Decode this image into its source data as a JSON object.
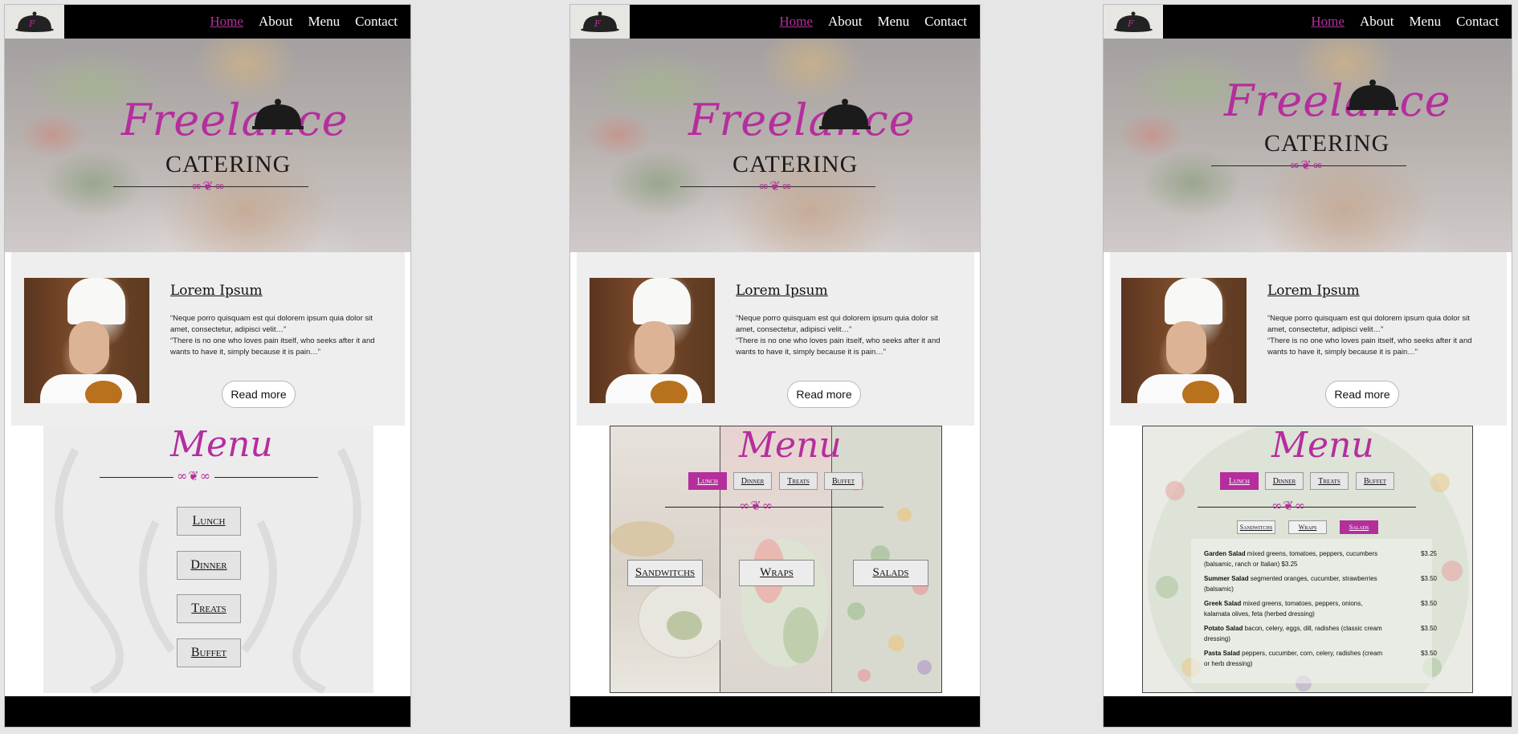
{
  "nav": {
    "items": [
      "Home",
      "About",
      "Menu",
      "Contact"
    ]
  },
  "brand": {
    "script": "Freelance",
    "block": "CATERING",
    "logo_icon": "cloche-icon"
  },
  "about": {
    "title": "Lorem Ipsum",
    "quote1": "“Neque porro quisquam est qui dolorem ipsum quia dolor sit amet, consectetur, adipisci velit…”",
    "quote2": "“There is no one who loves pain itself, who seeks after it and wants to have it, simply because it is pain…”",
    "button": "Read more"
  },
  "menu": {
    "title": "Menu",
    "categories": [
      "Lunch",
      "Dinner",
      "Treats",
      "Buffet"
    ],
    "lunch_sections": [
      "Sandwitchs",
      "Wraps",
      "Salads"
    ],
    "salads": [
      {
        "name": "Garden Salad",
        "desc": " mixed greens, tomatoes, peppers, cucumbers (balsamic, ranch or Italian) $3.25",
        "price": "$3.25"
      },
      {
        "name": "Summer Salad",
        "desc": "  segmented oranges, cucumber, strawberries (balsamic)",
        "price": "$3.50"
      },
      {
        "name": "Greek Salad",
        "desc": "  mixed greens, tomatoes, peppers, onions, kalamata olives, feta (herbed dressing)",
        "price": "$3.50"
      },
      {
        "name": "Potato Salad",
        "desc": "  bacon, celery, eggs, dill, radishes (classic cream dressing)",
        "price": "$3.50"
      },
      {
        "name": "Pasta Salad",
        "desc": "  peppers, cucumber, corn, celery, radishes (cream or herb dressing)",
        "price": "$3.50"
      }
    ]
  },
  "colors": {
    "accent": "#b52e9d",
    "nav_bg": "#000000",
    "panel_bg": "#eeeeee"
  }
}
